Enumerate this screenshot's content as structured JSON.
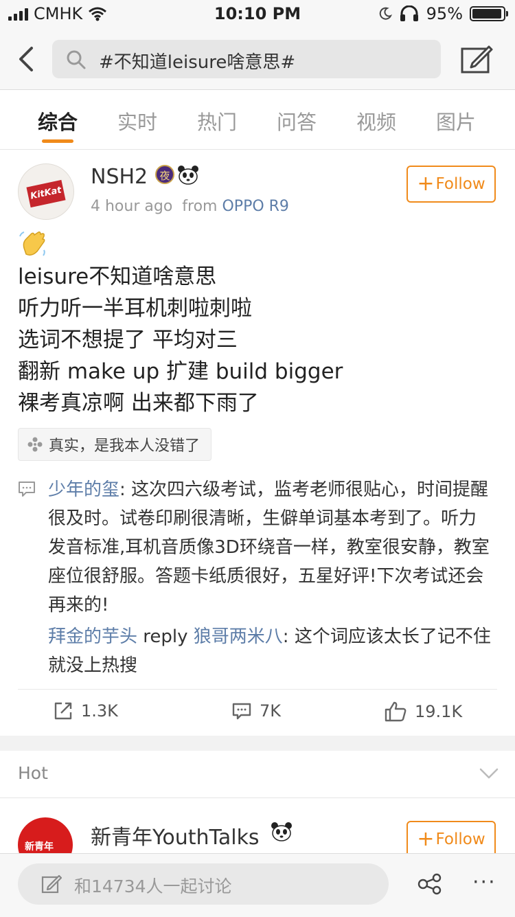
{
  "status_bar": {
    "carrier": "CMHK",
    "time": "10:10 PM",
    "battery": "95%",
    "battery_level": 0.95
  },
  "search": {
    "query": "#不知道leisure啥意思#"
  },
  "tabs": [
    {
      "label": "综合",
      "active": true
    },
    {
      "label": "实时"
    },
    {
      "label": "热门"
    },
    {
      "label": "问答"
    },
    {
      "label": "视频"
    },
    {
      "label": "图片"
    }
  ],
  "post": {
    "username": "NSH2",
    "night_badge": "夜",
    "time_ago": "4 hour ago",
    "from_label": "from",
    "device": "OPPO R9",
    "follow_label": "Follow",
    "lines": [
      "leisure不知道啥意思",
      "听力听一半耳机刺啦刺啦",
      "选词不想提了 平均对三",
      "翻新 make up 扩建 build bigger",
      "裸考真凉啊 出来都下雨了"
    ],
    "location_tag": "真实，是我本人没错了",
    "comments": [
      {
        "user": "少年的玺",
        "text": ": 这次四六级考试，监考老师很贴心，时间提醒很及时。试卷印刷很清晰，生僻单词基本考到了。听力发音标准,耳机音质像3D环绕音一样，教室很安静，教室座位很舒服。答题卡纸质很好，五星好评!下次考试还会再来的!"
      },
      {
        "user": "拜金的芋头",
        "reply_word": " reply ",
        "reply_to": "狼哥两米八",
        "text": ": 这个词应该太长了记不住就没上热搜"
      }
    ],
    "reposts": "1.3K",
    "comment_count": "7K",
    "likes": "19.1K"
  },
  "hot_section": {
    "label": "Hot"
  },
  "next_post": {
    "username": "新青年YouthTalks",
    "avatar_text": "新青年",
    "follow_label": "Follow"
  },
  "bottom_bar": {
    "discuss_placeholder": "和14734人一起讨论",
    "more_label": "···"
  }
}
